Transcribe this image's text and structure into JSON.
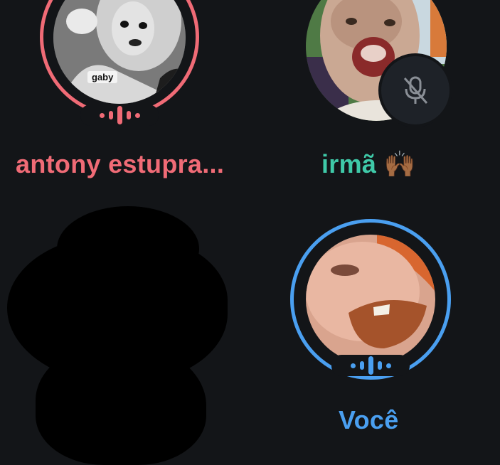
{
  "colors": {
    "background": "#131518",
    "speaking_red": "#f06b76",
    "speaking_blue": "#4a9ff0",
    "name_red": "#f06b76",
    "name_teal": "#3fc9a8",
    "name_blue": "#4a9ff0",
    "mute_badge_bg": "#1e2228",
    "mute_icon": "#8a8f96"
  },
  "participants": [
    {
      "name": "antony estupra...",
      "speaking": true,
      "muted": false,
      "avatar_tag": "gaby",
      "ring_color": "#f06b76"
    },
    {
      "name": "irmã 🙌🏾",
      "speaking": false,
      "muted": true,
      "ring_color": "none"
    },
    {
      "name": "",
      "speaking": false,
      "muted": false,
      "redacted": true
    },
    {
      "name": "Você",
      "speaking": true,
      "muted": false,
      "ring_color": "#4a9ff0"
    }
  ]
}
